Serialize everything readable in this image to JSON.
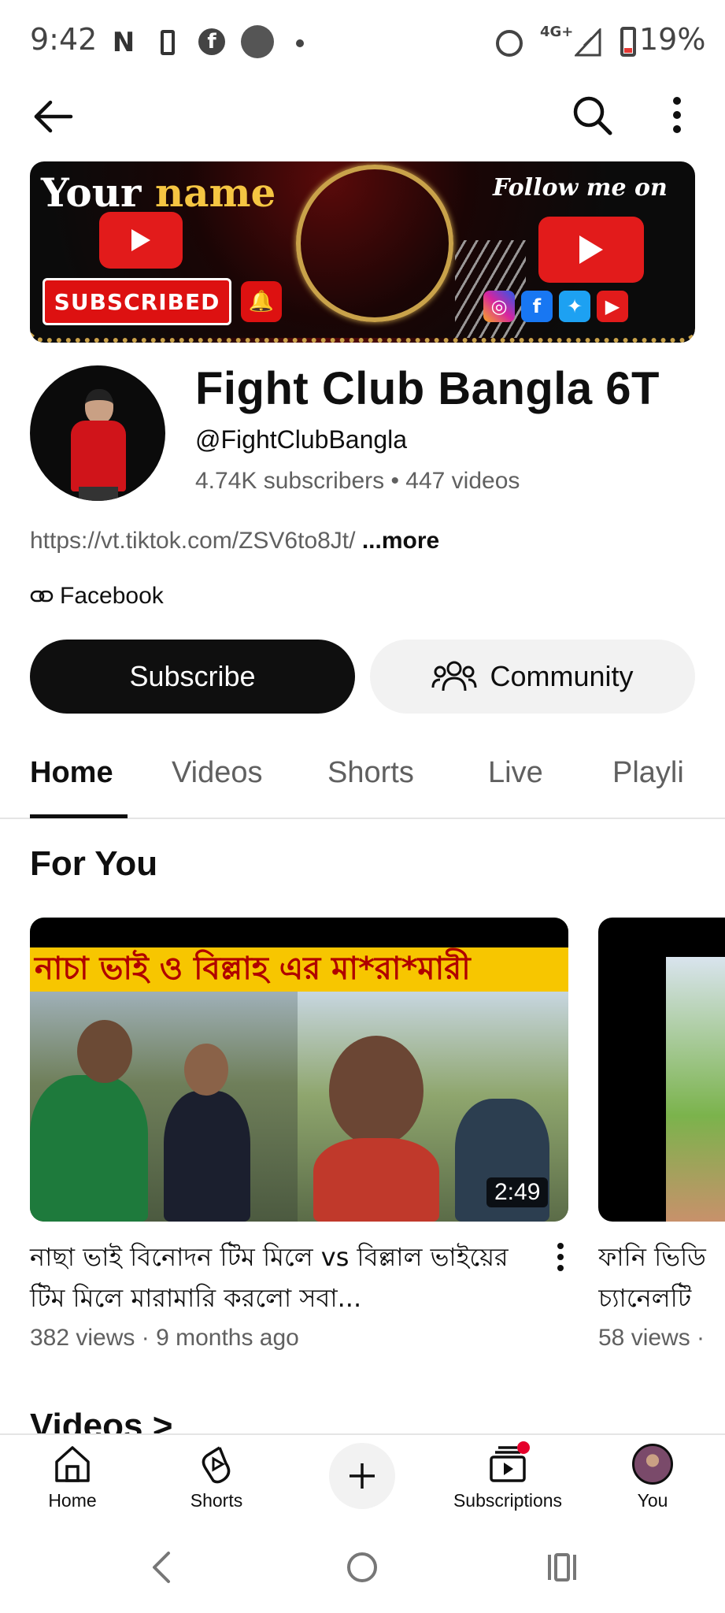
{
  "status_bar": {
    "time": "9:42",
    "notification_n": "N",
    "facebook_glyph": "f",
    "network": "4G+",
    "battery_percent": "19%"
  },
  "banner": {
    "name_word1": "Your",
    "name_word2": "name",
    "subscribed": "SUBSCRIBED",
    "follow": "Follow me on"
  },
  "channel": {
    "name": "Fight Club Bangla 6T",
    "handle": "@FightClubBangla",
    "stats": "4.74K subscribers • 447 videos",
    "link_url": "https://vt.tiktok.com/ZSV6to8Jt/",
    "more_label": "...more",
    "facebook_label": "Facebook"
  },
  "actions": {
    "subscribe": "Subscribe",
    "community": "Community"
  },
  "tabs": [
    {
      "label": "Home",
      "active": true
    },
    {
      "label": "Videos",
      "active": false
    },
    {
      "label": "Shorts",
      "active": false
    },
    {
      "label": "Live",
      "active": false
    },
    {
      "label": "Playli",
      "active": false
    }
  ],
  "for_you": {
    "title": "For You",
    "videos": [
      {
        "thumb_text": "নাচা ভাই ও বিল্লাহ এর মা*রা*মারী",
        "duration": "2:49",
        "title": "নাছা ভাই বিনোদন টিম মিলে vs বিল্লাল ভাইয়ের টিম মিলে মারামারি করলো সবা...",
        "meta": "382 views · 9 months ago"
      },
      {
        "title": "ফানি ভিডি",
        "title_line2": "চ্যানেলটি",
        "meta": "58 views ·"
      }
    ]
  },
  "videos_heading": "Videos >",
  "bottom_nav": {
    "home": "Home",
    "shorts": "Shorts",
    "subscriptions": "Subscriptions",
    "you": "You"
  },
  "colors": {
    "accent_red": "#e21b1b",
    "text_primary": "#0f0f0f",
    "text_secondary": "#606060",
    "chip_bg": "#f2f2f2"
  },
  "icons": [
    "back-arrow-icon",
    "search-icon",
    "more-vert-icon",
    "link-icon",
    "community-icon",
    "home-icon",
    "shorts-icon",
    "create-plus-icon",
    "subscriptions-icon"
  ]
}
